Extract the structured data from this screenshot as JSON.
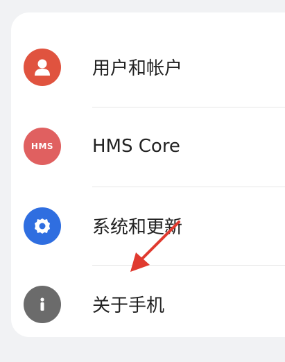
{
  "settings": {
    "items": [
      {
        "label": "用户和帐户",
        "icon": "user-icon",
        "color": "#e0533f"
      },
      {
        "label": "HMS Core",
        "icon": "hms-icon",
        "icon_text": "HMS",
        "color": "#e06060"
      },
      {
        "label": "系统和更新",
        "icon": "gear-icon",
        "color": "#2f6ee0"
      },
      {
        "label": "关于手机",
        "icon": "info-icon",
        "color": "#6b6b6b"
      }
    ]
  },
  "annotation": {
    "icon": "red-arrow-icon",
    "color": "#e03a2f"
  }
}
